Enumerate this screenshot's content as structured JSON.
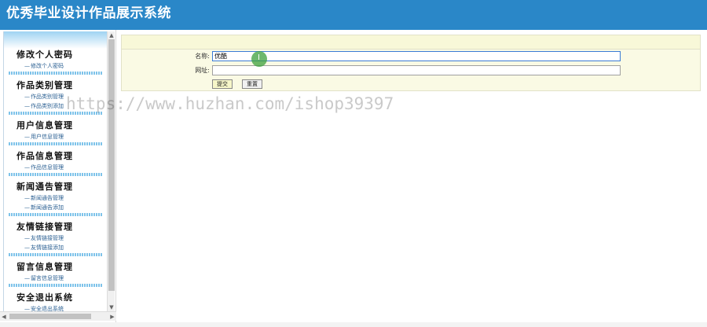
{
  "header": {
    "title": "优秀毕业设计作品展示系统"
  },
  "sidebar": {
    "groups": [
      {
        "title": "修改个人密码",
        "items": [
          "修改个人密码"
        ]
      },
      {
        "title": "作品类别管理",
        "items": [
          "作品类别管理",
          "作品类别添加"
        ]
      },
      {
        "title": "用户信息管理",
        "items": [
          "用户信息管理"
        ]
      },
      {
        "title": "作品信息管理",
        "items": [
          "作品信息管理"
        ]
      },
      {
        "title": "新闻通告管理",
        "items": [
          "新闻通告管理",
          "新闻通告添加"
        ]
      },
      {
        "title": "友情链接管理",
        "items": [
          "友情链接管理",
          "友情链接添加"
        ]
      },
      {
        "title": "留言信息管理",
        "items": [
          "留言信息管理"
        ]
      },
      {
        "title": "安全退出系统",
        "items": [
          "安全退出系统"
        ]
      }
    ]
  },
  "form": {
    "name_label": "名称:",
    "name_value": "优酷",
    "url_label": "网址:",
    "url_value": "",
    "submit_label": "提交",
    "reset_label": "重置"
  },
  "watermark": "https://www.huzhan.com/ishop39397",
  "colors": {
    "header": "#2a87c8",
    "form_bg": "#fafae4"
  }
}
